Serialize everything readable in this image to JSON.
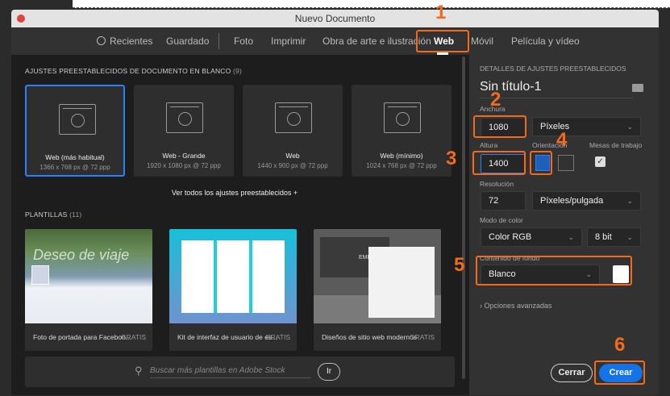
{
  "window": {
    "title": "Nuevo Documento"
  },
  "tabs": [
    {
      "label": "Recientes",
      "icon": "clock-icon"
    },
    {
      "label": "Guardado"
    },
    {
      "label": "Foto"
    },
    {
      "label": "Imprimir"
    },
    {
      "label": "Obra de arte e ilustración"
    },
    {
      "label": "Web",
      "active": true
    },
    {
      "label": "Móvil"
    },
    {
      "label": "Película y vídeo"
    }
  ],
  "presets": {
    "heading": "AJUSTES PREESTABLECIDOS DE DOCUMENTO EN BLANCO",
    "count": "(9)",
    "items": [
      {
        "name": "Web (más habitual)",
        "desc": "1366 x 768 px @ 72 ppp",
        "selected": true
      },
      {
        "name": "Web - Grande",
        "desc": "1920 x 1080 px @ 72 ppp"
      },
      {
        "name": "Web",
        "desc": "1440 x 900 px @ 72 ppp"
      },
      {
        "name": "Web (mínimo)",
        "desc": "1024 x 768 px @ 72 ppp"
      }
    ],
    "view_all": "Ver todos los ajustes preestablecidos +"
  },
  "templates": {
    "heading": "PLANTILLAS",
    "count": "(11)",
    "items": [
      {
        "name": "Foto de portada para Faceboo...",
        "price": "GRATIS",
        "thumb_text": "Deseo de viaje"
      },
      {
        "name": "Kit de interfaz de usuario de es...",
        "price": "GRATIS"
      },
      {
        "name": "Diseños de sitio web modernos",
        "price": "GRATIS",
        "thumb_text": "EMPRESA"
      }
    ]
  },
  "search": {
    "placeholder": "Buscar más plantillas en Adobe Stock",
    "go": "Ir"
  },
  "details": {
    "heading": "DETALLES DE AJUSTES PREESTABLECIDOS",
    "doc_name": "Sin título-1",
    "width_label": "Anchura",
    "width": "1080",
    "unit": "Píxeles",
    "height_label": "Altura",
    "height": "1400",
    "orientation_label": "Orientación",
    "orientation": "portrait",
    "artboards_label": "Mesas de trabajo",
    "artboards": true,
    "resolution_label": "Resolución",
    "resolution": "72",
    "resolution_unit": "Píxeles/pulgada",
    "color_mode_label": "Modo de color",
    "color_mode": "Color RGB",
    "bit_depth": "8 bit",
    "background_label": "Contenido de fondo",
    "background": "Blanco",
    "background_color": "#ffffff",
    "advanced": "Opciones avanzadas"
  },
  "buttons": {
    "close": "Cerrar",
    "create": "Crear"
  },
  "annotations": [
    "1",
    "2",
    "3",
    "4",
    "5",
    "6"
  ],
  "colors": {
    "accent": "#2d7ff9",
    "annotation": "#f26b1d"
  }
}
